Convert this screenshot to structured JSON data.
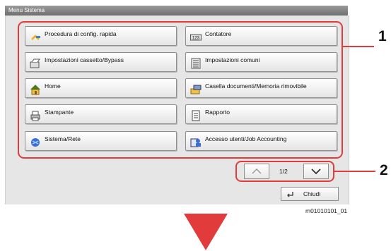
{
  "window": {
    "title": "Menu Sistema"
  },
  "menu": {
    "left": [
      {
        "label": "Procedura di config. rapida",
        "icon": "quick-setup-icon"
      },
      {
        "label": "Impostazioni cassetto/Bypass",
        "icon": "cassette-icon"
      },
      {
        "label": "Home",
        "icon": "home-icon"
      },
      {
        "label": "Stampante",
        "icon": "printer-icon"
      },
      {
        "label": "Sistema/Rete",
        "icon": "system-network-icon"
      }
    ],
    "right": [
      {
        "label": "Contatore",
        "icon": "counter-icon"
      },
      {
        "label": "Impostazioni comuni",
        "icon": "common-settings-icon"
      },
      {
        "label": "Casella documenti/Memoria rimovibile",
        "icon": "document-box-icon"
      },
      {
        "label": "Rapporto",
        "icon": "report-icon"
      },
      {
        "label": "Accesso utenti/Job Accounting",
        "icon": "user-login-icon"
      }
    ]
  },
  "pager": {
    "indicator": "1/2"
  },
  "footer": {
    "close_label": "Chiudi",
    "code": "m01010101_01"
  },
  "callouts": {
    "one": "1",
    "two": "2"
  },
  "colors": {
    "accent": "#e23b3b",
    "title_bar": "#7a7a7a"
  }
}
